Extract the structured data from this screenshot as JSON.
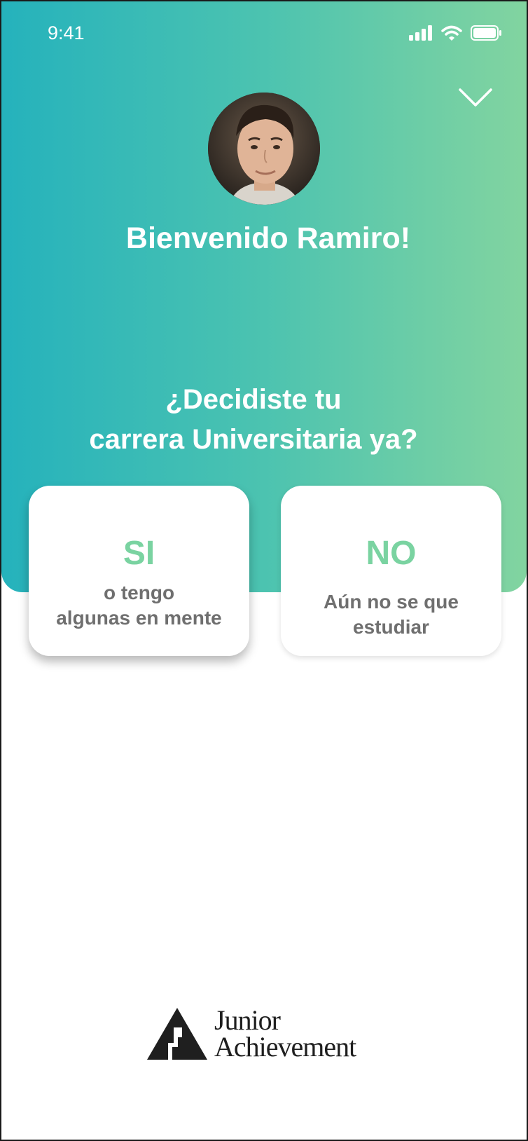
{
  "status_bar": {
    "time": "9:41"
  },
  "header": {
    "welcome": "Bienvenido Ramiro!"
  },
  "question": {
    "line1": "¿Decidiste tu",
    "line2": "carrera Universitaria ya?"
  },
  "options": {
    "yes": {
      "title": "SI",
      "line1": "o tengo",
      "line2": "algunas en mente"
    },
    "no": {
      "title": "NO",
      "line1": "Aún no se que",
      "line2": "estudiar"
    }
  },
  "footer": {
    "logo_line1": "Junior",
    "logo_line2": "Achievement"
  },
  "colors": {
    "gradient_start": "#25b2bc",
    "gradient_end": "#82d4a0",
    "option_title": "#7ad3a1",
    "option_text": "#6f6f6f"
  },
  "icons": {
    "collapse": "chevron-down-icon",
    "signal": "signal-icon",
    "wifi": "wifi-icon",
    "battery": "battery-icon"
  }
}
